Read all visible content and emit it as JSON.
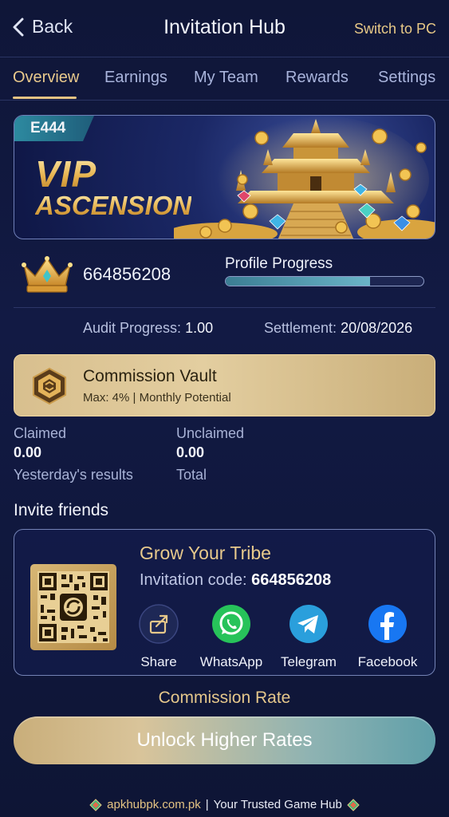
{
  "header": {
    "back_label": "Back",
    "title": "Invitation Hub",
    "switch_label": "Switch to PC"
  },
  "tabs": [
    {
      "label": "Overview",
      "active": true
    },
    {
      "label": "Earnings",
      "active": false
    },
    {
      "label": "My Team",
      "active": false
    },
    {
      "label": "Rewards",
      "active": false
    },
    {
      "label": "Settings",
      "active": false
    }
  ],
  "banner": {
    "badge": "E444",
    "line1": "VIP",
    "line2": "ASCENSION"
  },
  "profile": {
    "user_id": "664856208",
    "progress_label": "Profile Progress",
    "progress_fraction": 0.73,
    "audit_label": "Audit Progress:",
    "audit_value": "1.00",
    "settlement_label": "Settlement:",
    "settlement_value": "20/08/2026"
  },
  "vault": {
    "title": "Commission Vault",
    "subtitle": "Max: 4% | Monthly Potential"
  },
  "stats": {
    "claimed_label": "Claimed",
    "claimed_value": "0.00",
    "claimed_sub": "Yesterday's results",
    "unclaimed_label": "Unclaimed",
    "unclaimed_value": "0.00",
    "unclaimed_sub": "Total"
  },
  "invite": {
    "heading": "Invite friends",
    "title": "Grow Your Tribe",
    "code_label": "Invitation code:",
    "code_value": "664856208",
    "socials": [
      {
        "label": "Share",
        "icon": "share-icon"
      },
      {
        "label": "WhatsApp",
        "icon": "whatsapp-icon"
      },
      {
        "label": "Telegram",
        "icon": "telegram-icon"
      },
      {
        "label": "Facebook",
        "icon": "facebook-icon"
      }
    ]
  },
  "commission_rate_label": "Commission Rate",
  "unlock_label": "Unlock Higher Rates",
  "footer": {
    "site": "apkhubpk.com.pk",
    "divider": "|",
    "tagline": "Your Trusted Game Hub"
  },
  "colors": {
    "accent_gold": "#e4c383",
    "background": "#121a44",
    "teal": "#5f9fa9"
  }
}
